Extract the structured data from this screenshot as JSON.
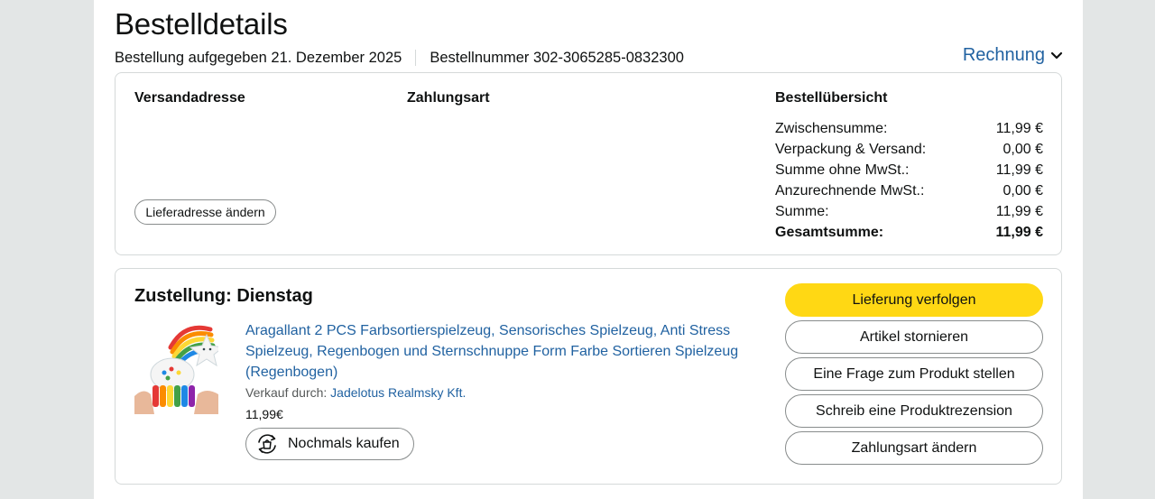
{
  "header": {
    "title": "Bestelldetails",
    "order_placed": "Bestellung aufgegeben 21. Dezember 2025",
    "order_number": "Bestellnummer 302-3065285-0832300",
    "invoice_label": "Rechnung"
  },
  "info": {
    "shipping_heading": "Versandadresse",
    "payment_heading": "Zahlungsart",
    "change_address_label": "Lieferadresse ändern",
    "summary_heading": "Bestellübersicht",
    "summary": [
      {
        "label": "Zwischensumme:",
        "value": "11,99 €"
      },
      {
        "label": "Verpackung & Versand:",
        "value": "0,00 €"
      },
      {
        "label": "Summe ohne MwSt.:",
        "value": "11,99 €"
      },
      {
        "label": "Anzurechnende MwSt.:",
        "value": "0,00 €"
      },
      {
        "label": "Summe:",
        "value": "11,99 €"
      },
      {
        "label": "Gesamtsumme:",
        "value": "11,99 €"
      }
    ]
  },
  "shipment": {
    "heading": "Zustellung: Dienstag",
    "product_title": "Aragallant 2 PCS Farbsortierspielzeug, Sensorisches Spielzeug, Anti Stress Spielzeug, Regenbogen und Sternschnuppe Form Farbe Sortieren Spielzeug (Regenbogen)",
    "seller_prefix": "Verkauf durch: ",
    "seller_name": "Jadelotus Realmsky Kft.",
    "price": "11,99€",
    "buy_again_label": "Nochmals kaufen",
    "actions": [
      "Lieferung verfolgen",
      "Artikel stornieren",
      "Eine Frage zum Produkt stellen",
      "Schreib eine Produktrezension",
      "Zahlungsart ändern"
    ]
  },
  "icons": {
    "invoice": "chevron-down-icon",
    "buy_again": "buy-again-icon"
  },
  "colors": {
    "link": "#2162a1",
    "primary_button": "#ffd814",
    "border": "#d5d9d9",
    "background": "#e3e6e6"
  }
}
